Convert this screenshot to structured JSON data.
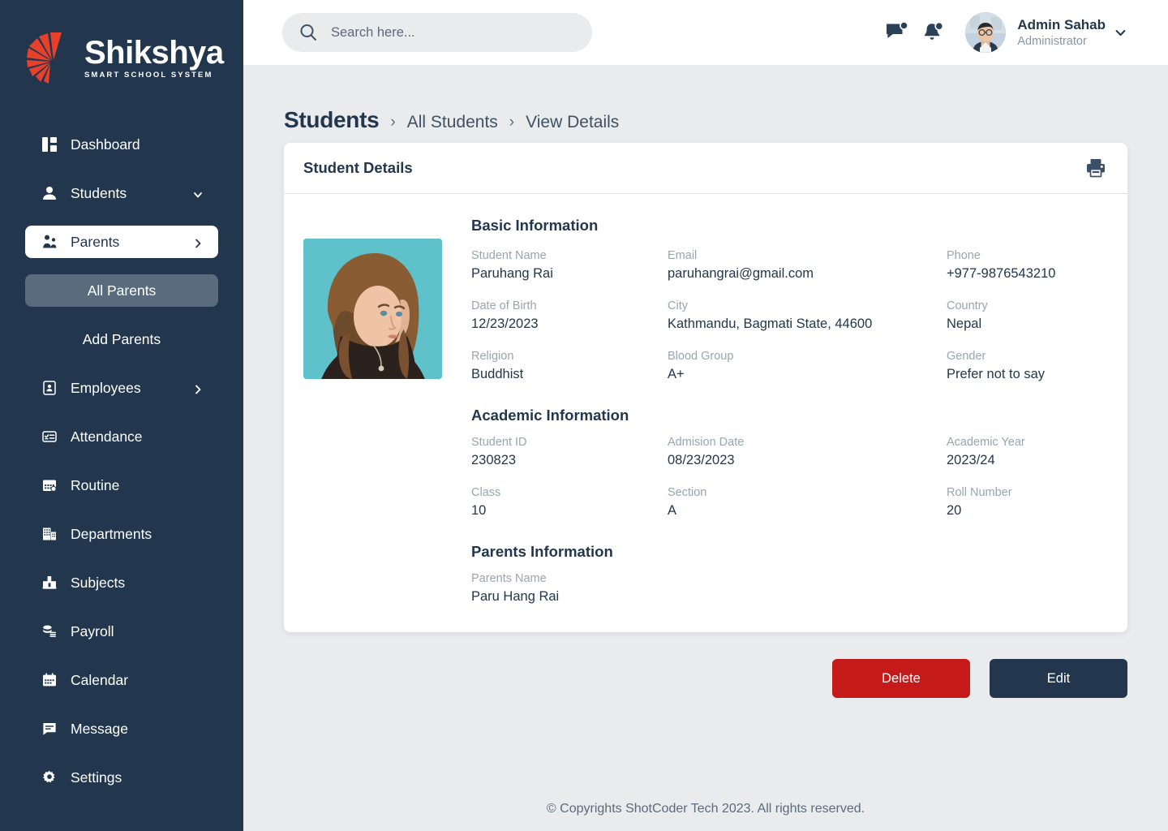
{
  "brand": {
    "name": "Shikshya",
    "tagline": "SMART SCHOOL SYSTEM",
    "logo_icon": "pinwheel-logo-icon",
    "accent_color": "#e8402a",
    "sidebar_color": "#22374e"
  },
  "sidebar": {
    "items": [
      {
        "label": "Dashboard",
        "icon": "grid-icon",
        "state": "default",
        "caret": "none"
      },
      {
        "label": "Students",
        "icon": "user-icon",
        "state": "default",
        "caret": "chevron-down-icon"
      },
      {
        "label": "Parents",
        "icon": "parents-icon",
        "state": "active",
        "caret": "chevron-right-icon"
      },
      {
        "label": "Employees",
        "icon": "id-badge-icon",
        "state": "default",
        "caret": "chevron-right-icon"
      },
      {
        "label": "Attendance",
        "icon": "checklist-icon",
        "state": "default",
        "caret": "none"
      },
      {
        "label": "Routine",
        "icon": "calendar-clock-icon",
        "state": "default",
        "caret": "none"
      },
      {
        "label": "Departments",
        "icon": "building-icon",
        "state": "default",
        "caret": "none"
      },
      {
        "label": "Subjects",
        "icon": "book-icon",
        "state": "default",
        "caret": "none"
      },
      {
        "label": "Payroll",
        "icon": "money-icon",
        "state": "default",
        "caret": "none"
      },
      {
        "label": "Calendar",
        "icon": "calendar-icon",
        "state": "default",
        "caret": "none"
      },
      {
        "label": "Message",
        "icon": "chat-icon",
        "state": "default",
        "caret": "none"
      },
      {
        "label": "Settings",
        "icon": "gear-icon",
        "state": "default",
        "caret": "none"
      }
    ],
    "submenu": [
      {
        "label": "All Parents",
        "state": "selected"
      },
      {
        "label": "Add Parents",
        "state": "default"
      }
    ]
  },
  "topbar": {
    "search": {
      "placeholder": "Search here...",
      "value": "",
      "icon": "search-icon"
    },
    "message_icon": "message-badge-icon",
    "notification_icon": "bell-badge-icon",
    "user": {
      "name": "Admin Sahab",
      "role": "Administrator",
      "avatar_alt": "admin-avatar",
      "caret_icon": "chevron-down-icon"
    }
  },
  "breadcrumb": {
    "current": "Students",
    "separator": "›",
    "trail": [
      "All Students",
      "View Details"
    ]
  },
  "card": {
    "title": "Student Details",
    "print_icon": "printer-icon",
    "photo_alt": "student-photo",
    "sections": [
      {
        "heading": "Basic Information",
        "fields": [
          {
            "label": "Student Name",
            "value": "Paruhang Rai"
          },
          {
            "label": "Email",
            "value": "paruhangrai@gmail.com"
          },
          {
            "label": "Phone",
            "value": "+977-9876543210"
          },
          {
            "label": "Date of Birth",
            "value": "12/23/2023"
          },
          {
            "label": "City",
            "value": "Kathmandu, Bagmati State, 44600"
          },
          {
            "label": "Country",
            "value": "Nepal"
          },
          {
            "label": "Religion",
            "value": "Buddhist"
          },
          {
            "label": "Blood Group",
            "value": "A+"
          },
          {
            "label": "Gender",
            "value": "Prefer not to say"
          }
        ]
      },
      {
        "heading": "Academic Information",
        "fields": [
          {
            "label": "Student ID",
            "value": "230823"
          },
          {
            "label": "Admision Date",
            "value": "08/23/2023"
          },
          {
            "label": "Academic Year",
            "value": "2023/24"
          },
          {
            "label": "Class",
            "value": "10"
          },
          {
            "label": "Section",
            "value": "A"
          },
          {
            "label": "Roll Number",
            "value": "20"
          }
        ]
      },
      {
        "heading": "Parents Information",
        "fields": [
          {
            "label": "Parents Name",
            "value": "Paru Hang Rai"
          }
        ]
      }
    ]
  },
  "actions": {
    "delete_label": "Delete",
    "edit_label": "Edit",
    "delete_color": "#c51a1a",
    "edit_color": "#22374e"
  },
  "footer": {
    "text": "© Copyrights ShotCoder Tech 2023. All rights reserved."
  }
}
